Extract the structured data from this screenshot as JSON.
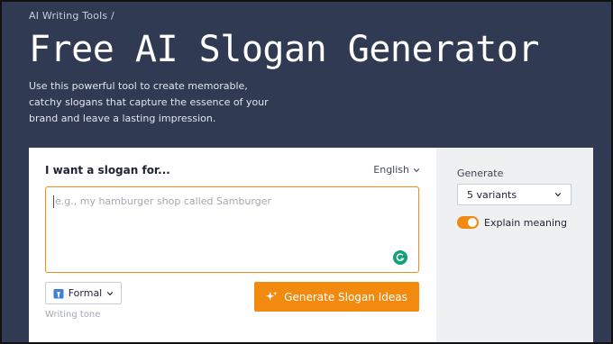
{
  "header": {
    "breadcrumb": "AI Writing Tools /",
    "title": "Free AI Slogan Generator",
    "subtitle": "Use this powerful tool to create memorable, catchy slogans that capture the essence of your brand and leave a lasting impression."
  },
  "form": {
    "prompt_label": "I want a slogan for...",
    "language": "English",
    "input_placeholder": "e.g., my hamburger shop called Samburger",
    "input_value": "",
    "tone_value": "Formal",
    "tone_caption": "Writing tone",
    "generate_label": "Generate Slogan Ideas"
  },
  "sidebar": {
    "generate_label": "Generate",
    "variants_value": "5 variants",
    "explain_label": "Explain meaning",
    "explain_enabled": true
  },
  "colors": {
    "header_bg": "#303a52",
    "accent": "#f38a10",
    "input_border": "#f08c1a",
    "grammar_icon": "#15a07a"
  },
  "icons": {
    "language_chevron": "chevron-down-icon",
    "tone": "necktie-icon",
    "generate": "sparkle-icon",
    "grammar": "grammarly-icon"
  }
}
